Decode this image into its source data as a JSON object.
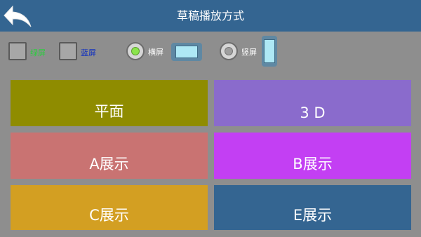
{
  "header": {
    "title": "草稿播放方式",
    "back_icon": "back-arrow-icon"
  },
  "options": {
    "checkbox_1": {
      "label": "绿屏",
      "color": "#2ecc40",
      "checked": false
    },
    "checkbox_2": {
      "label": "蓝屏",
      "color": "#1030c0",
      "checked": false
    },
    "radio_landscape": {
      "label": "横屏",
      "selected": true,
      "icon": "landscape-device-icon"
    },
    "radio_portrait": {
      "label": "竖屏",
      "selected": false,
      "icon": "portrait-device-icon"
    }
  },
  "tiles": [
    {
      "label": "平面",
      "color": "#8f8c00"
    },
    {
      "label": "3 D",
      "color": "#8a6bcc"
    },
    {
      "label": "A展示",
      "color": "#c97372"
    },
    {
      "label": "B展示",
      "color": "#c33ff3"
    },
    {
      "label": "C展示",
      "color": "#d39f22"
    },
    {
      "label": "E展示",
      "color": "#346591"
    }
  ]
}
